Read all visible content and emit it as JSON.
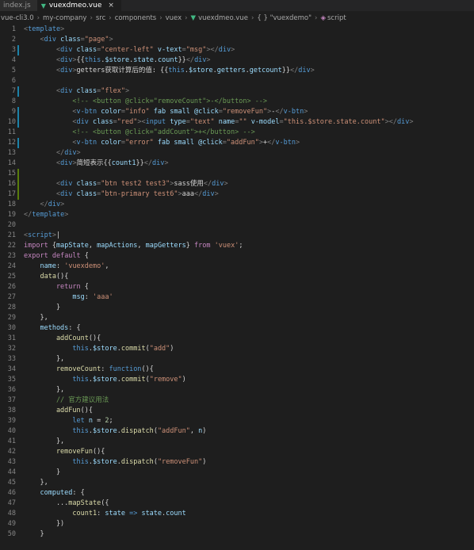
{
  "tabs": [
    {
      "label": "index.js",
      "active": false
    },
    {
      "label": "vuexdmeo.vue",
      "active": true,
      "close": "×"
    }
  ],
  "breadcrumb": [
    "vue-cli3.0",
    "my-company",
    "src",
    "components",
    "vuex",
    "vuexdmeo.vue",
    "{ } \"vuexdemo\"",
    "script"
  ],
  "lines": [
    {
      "n": "1",
      "bar": "",
      "segs": [
        [
          "p",
          "<"
        ],
        [
          "t",
          "template"
        ],
        [
          "p",
          ">"
        ]
      ]
    },
    {
      "n": "2",
      "bar": "",
      "segs": [
        [
          "p",
          "    <"
        ],
        [
          "t",
          "div"
        ],
        [
          "a",
          " class"
        ],
        [
          "p",
          "="
        ],
        [
          "s",
          "\"page\""
        ],
        [
          "p",
          ">"
        ]
      ]
    },
    {
      "n": "3",
      "bar": "mod",
      "segs": [
        [
          "p",
          "        <"
        ],
        [
          "t",
          "div"
        ],
        [
          "a",
          " class"
        ],
        [
          "p",
          "="
        ],
        [
          "s",
          "\"center-left\""
        ],
        [
          "a",
          " v-text"
        ],
        [
          "p",
          "="
        ],
        [
          "s",
          "\"msg\""
        ],
        [
          "p",
          "></"
        ],
        [
          "t",
          "div"
        ],
        [
          "p",
          ">"
        ]
      ]
    },
    {
      "n": "4",
      "bar": "",
      "segs": [
        [
          "p",
          "        <"
        ],
        [
          "t",
          "div"
        ],
        [
          "p",
          ">"
        ],
        [
          "x",
          "{{"
        ],
        [
          "b",
          "this"
        ],
        [
          "x",
          "."
        ],
        [
          "v",
          "$store"
        ],
        [
          "x",
          "."
        ],
        [
          "v",
          "state"
        ],
        [
          "x",
          "."
        ],
        [
          "v",
          "count"
        ],
        [
          "x",
          "}}"
        ],
        [
          "p",
          "</"
        ],
        [
          "t",
          "div"
        ],
        [
          "p",
          ">"
        ]
      ]
    },
    {
      "n": "5",
      "bar": "",
      "segs": [
        [
          "p",
          "        <"
        ],
        [
          "t",
          "div"
        ],
        [
          "p",
          ">"
        ],
        [
          "x",
          "getters获取计算后的值: {{"
        ],
        [
          "b",
          "this"
        ],
        [
          "x",
          "."
        ],
        [
          "v",
          "$store"
        ],
        [
          "x",
          "."
        ],
        [
          "v",
          "getters"
        ],
        [
          "x",
          "."
        ],
        [
          "v",
          "getcount"
        ],
        [
          "x",
          "}}"
        ],
        [
          "p",
          "</"
        ],
        [
          "t",
          "div"
        ],
        [
          "p",
          ">"
        ]
      ]
    },
    {
      "n": "6",
      "bar": "",
      "segs": []
    },
    {
      "n": "7",
      "bar": "mod",
      "segs": [
        [
          "p",
          "        <"
        ],
        [
          "t",
          "div"
        ],
        [
          "a",
          " class"
        ],
        [
          "p",
          "="
        ],
        [
          "s",
          "\"flex\""
        ],
        [
          "p",
          ">"
        ]
      ]
    },
    {
      "n": "8",
      "bar": "",
      "segs": [
        [
          "c",
          "            <!-- <button @click=\"removeCount\">-</button> -->"
        ]
      ]
    },
    {
      "n": "9",
      "bar": "mod",
      "segs": [
        [
          "p",
          "            <"
        ],
        [
          "t",
          "v-btn"
        ],
        [
          "a",
          " color"
        ],
        [
          "p",
          "="
        ],
        [
          "s",
          "\"info\""
        ],
        [
          "a",
          " fab small @click"
        ],
        [
          "p",
          "="
        ],
        [
          "s",
          "\"removeFun\""
        ],
        [
          "p",
          ">"
        ],
        [
          "x",
          "-"
        ],
        [
          "p",
          "</"
        ],
        [
          "t",
          "v-btn"
        ],
        [
          "p",
          ">"
        ]
      ]
    },
    {
      "n": "10",
      "bar": "mod",
      "segs": [
        [
          "p",
          "            <"
        ],
        [
          "t",
          "div"
        ],
        [
          "a",
          " class"
        ],
        [
          "p",
          "="
        ],
        [
          "s",
          "\"red\""
        ],
        [
          "p",
          "><"
        ],
        [
          "t",
          "input"
        ],
        [
          "a",
          " type"
        ],
        [
          "p",
          "="
        ],
        [
          "s",
          "\"text\""
        ],
        [
          "a",
          " name"
        ],
        [
          "p",
          "="
        ],
        [
          "s",
          "\"\""
        ],
        [
          "a",
          " v-model"
        ],
        [
          "p",
          "="
        ],
        [
          "s",
          "\"this.$store.state.count\""
        ],
        [
          "p",
          "></"
        ],
        [
          "t",
          "div"
        ],
        [
          "p",
          ">"
        ]
      ]
    },
    {
      "n": "11",
      "bar": "",
      "segs": [
        [
          "c",
          "            <!-- <button @click=\"addCount\">+</button> -->"
        ]
      ]
    },
    {
      "n": "12",
      "bar": "mod",
      "segs": [
        [
          "p",
          "            <"
        ],
        [
          "t",
          "v-btn"
        ],
        [
          "a",
          " color"
        ],
        [
          "p",
          "="
        ],
        [
          "s",
          "\"error\""
        ],
        [
          "a",
          " fab small @click"
        ],
        [
          "p",
          "="
        ],
        [
          "s",
          "\"addFun\""
        ],
        [
          "p",
          ">"
        ],
        [
          "x",
          "+"
        ],
        [
          "p",
          "</"
        ],
        [
          "t",
          "v-btn"
        ],
        [
          "p",
          ">"
        ]
      ]
    },
    {
      "n": "13",
      "bar": "",
      "segs": [
        [
          "p",
          "        </"
        ],
        [
          "t",
          "div"
        ],
        [
          "p",
          ">"
        ]
      ]
    },
    {
      "n": "14",
      "bar": "",
      "segs": [
        [
          "p",
          "        <"
        ],
        [
          "t",
          "div"
        ],
        [
          "p",
          ">"
        ],
        [
          "x",
          "简短表示{{"
        ],
        [
          "v",
          "count1"
        ],
        [
          "x",
          "}}"
        ],
        [
          "p",
          "</"
        ],
        [
          "t",
          "div"
        ],
        [
          "p",
          ">"
        ]
      ]
    },
    {
      "n": "15",
      "bar": "add",
      "segs": []
    },
    {
      "n": "16",
      "bar": "add",
      "segs": [
        [
          "p",
          "        <"
        ],
        [
          "t",
          "div"
        ],
        [
          "a",
          " class"
        ],
        [
          "p",
          "="
        ],
        [
          "s",
          "\"btn test2 test3\""
        ],
        [
          "p",
          ">"
        ],
        [
          "x",
          "sass使用"
        ],
        [
          "p",
          "</"
        ],
        [
          "t",
          "div"
        ],
        [
          "p",
          ">"
        ]
      ]
    },
    {
      "n": "17",
      "bar": "add",
      "segs": [
        [
          "p",
          "        <"
        ],
        [
          "t",
          "div"
        ],
        [
          "a",
          " class"
        ],
        [
          "p",
          "="
        ],
        [
          "s",
          "\"btn-primary test6\""
        ],
        [
          "p",
          ">"
        ],
        [
          "x",
          "aaa"
        ],
        [
          "p",
          "</"
        ],
        [
          "t",
          "div"
        ],
        [
          "p",
          ">"
        ]
      ]
    },
    {
      "n": "18",
      "bar": "",
      "segs": [
        [
          "p",
          "    </"
        ],
        [
          "t",
          "div"
        ],
        [
          "p",
          ">"
        ]
      ]
    },
    {
      "n": "19",
      "bar": "",
      "segs": [
        [
          "p",
          "</"
        ],
        [
          "t",
          "template"
        ],
        [
          "p",
          ">"
        ]
      ]
    },
    {
      "n": "20",
      "bar": "",
      "segs": []
    },
    {
      "n": "21",
      "bar": "",
      "segs": [
        [
          "p",
          "<"
        ],
        [
          "t",
          "script"
        ],
        [
          "p",
          ">"
        ],
        [
          "x",
          "|"
        ]
      ]
    },
    {
      "n": "22",
      "bar": "",
      "segs": [
        [
          "k",
          "import"
        ],
        [
          "x",
          " {"
        ],
        [
          "v",
          "mapState"
        ],
        [
          "x",
          ", "
        ],
        [
          "v",
          "mapActions"
        ],
        [
          "x",
          ", "
        ],
        [
          "v",
          "mapGetters"
        ],
        [
          "x",
          "} "
        ],
        [
          "k",
          "from"
        ],
        [
          "s",
          " 'vuex'"
        ],
        [
          "x",
          ";"
        ]
      ]
    },
    {
      "n": "23",
      "bar": "",
      "segs": [
        [
          "k",
          "export"
        ],
        [
          "k",
          " default"
        ],
        [
          "x",
          " {"
        ]
      ]
    },
    {
      "n": "24",
      "bar": "",
      "segs": [
        [
          "v",
          "    name"
        ],
        [
          "x",
          ": "
        ],
        [
          "s",
          "'vuexdemo'"
        ],
        [
          "x",
          ","
        ]
      ]
    },
    {
      "n": "25",
      "bar": "",
      "segs": [
        [
          "f",
          "    data"
        ],
        [
          "x",
          "(){"
        ]
      ]
    },
    {
      "n": "26",
      "bar": "",
      "segs": [
        [
          "k",
          "        return"
        ],
        [
          "x",
          " {"
        ]
      ]
    },
    {
      "n": "27",
      "bar": "",
      "segs": [
        [
          "v",
          "            msg"
        ],
        [
          "x",
          ": "
        ],
        [
          "s",
          "'aaa'"
        ]
      ]
    },
    {
      "n": "28",
      "bar": "",
      "segs": [
        [
          "x",
          "        }"
        ]
      ]
    },
    {
      "n": "29",
      "bar": "",
      "segs": [
        [
          "x",
          "    },"
        ]
      ]
    },
    {
      "n": "30",
      "bar": "",
      "segs": [
        [
          "v",
          "    methods"
        ],
        [
          "x",
          ": {"
        ]
      ]
    },
    {
      "n": "31",
      "bar": "",
      "segs": [
        [
          "f",
          "        addCount"
        ],
        [
          "x",
          "(){"
        ]
      ]
    },
    {
      "n": "32",
      "bar": "",
      "segs": [
        [
          "b",
          "            this"
        ],
        [
          "x",
          "."
        ],
        [
          "v",
          "$store"
        ],
        [
          "x",
          "."
        ],
        [
          "f",
          "commit"
        ],
        [
          "x",
          "("
        ],
        [
          "s",
          "\"add\""
        ],
        [
          "x",
          ")"
        ]
      ]
    },
    {
      "n": "33",
      "bar": "",
      "segs": [
        [
          "x",
          "        },"
        ]
      ]
    },
    {
      "n": "34",
      "bar": "",
      "segs": [
        [
          "f",
          "        removeCount"
        ],
        [
          "x",
          ": "
        ],
        [
          "b",
          "function"
        ],
        [
          "x",
          "(){"
        ]
      ]
    },
    {
      "n": "35",
      "bar": "",
      "segs": [
        [
          "b",
          "            this"
        ],
        [
          "x",
          "."
        ],
        [
          "v",
          "$store"
        ],
        [
          "x",
          "."
        ],
        [
          "f",
          "commit"
        ],
        [
          "x",
          "("
        ],
        [
          "s",
          "\"remove\""
        ],
        [
          "x",
          ")"
        ]
      ]
    },
    {
      "n": "36",
      "bar": "",
      "segs": [
        [
          "x",
          "        },"
        ]
      ]
    },
    {
      "n": "37",
      "bar": "",
      "segs": [
        [
          "c",
          "        // 官方建议用法"
        ]
      ]
    },
    {
      "n": "38",
      "bar": "",
      "segs": [
        [
          "f",
          "        addFun"
        ],
        [
          "x",
          "(){"
        ]
      ]
    },
    {
      "n": "39",
      "bar": "",
      "segs": [
        [
          "b",
          "            let"
        ],
        [
          "v",
          " n"
        ],
        [
          "x",
          " = "
        ],
        [
          "n",
          "2"
        ],
        [
          "x",
          ";"
        ]
      ]
    },
    {
      "n": "40",
      "bar": "",
      "segs": [
        [
          "b",
          "            this"
        ],
        [
          "x",
          "."
        ],
        [
          "v",
          "$store"
        ],
        [
          "x",
          "."
        ],
        [
          "f",
          "dispatch"
        ],
        [
          "x",
          "("
        ],
        [
          "s",
          "\"addFun\""
        ],
        [
          "x",
          ", "
        ],
        [
          "v",
          "n"
        ],
        [
          "x",
          ")"
        ]
      ]
    },
    {
      "n": "41",
      "bar": "",
      "segs": [
        [
          "x",
          "        },"
        ]
      ]
    },
    {
      "n": "42",
      "bar": "",
      "segs": [
        [
          "f",
          "        removeFun"
        ],
        [
          "x",
          "(){"
        ]
      ]
    },
    {
      "n": "43",
      "bar": "",
      "segs": [
        [
          "b",
          "            this"
        ],
        [
          "x",
          "."
        ],
        [
          "v",
          "$store"
        ],
        [
          "x",
          "."
        ],
        [
          "f",
          "dispatch"
        ],
        [
          "x",
          "("
        ],
        [
          "s",
          "\"removeFun\""
        ],
        [
          "x",
          ")"
        ]
      ]
    },
    {
      "n": "44",
      "bar": "",
      "segs": [
        [
          "x",
          "        }"
        ]
      ]
    },
    {
      "n": "45",
      "bar": "",
      "segs": [
        [
          "x",
          "    },"
        ]
      ]
    },
    {
      "n": "46",
      "bar": "",
      "segs": [
        [
          "v",
          "    computed"
        ],
        [
          "x",
          ": {"
        ]
      ]
    },
    {
      "n": "47",
      "bar": "",
      "segs": [
        [
          "x",
          "        ..."
        ],
        [
          "f",
          "mapState"
        ],
        [
          "x",
          "({"
        ]
      ]
    },
    {
      "n": "48",
      "bar": "",
      "segs": [
        [
          "f",
          "            count1"
        ],
        [
          "x",
          ": "
        ],
        [
          "v",
          "state"
        ],
        [
          "b",
          " =>"
        ],
        [
          "v",
          " state"
        ],
        [
          "x",
          "."
        ],
        [
          "v",
          "count"
        ]
      ]
    },
    {
      "n": "49",
      "bar": "",
      "segs": [
        [
          "x",
          "        })"
        ]
      ]
    },
    {
      "n": "50",
      "bar": "",
      "segs": [
        [
          "x",
          "    }"
        ]
      ]
    }
  ]
}
